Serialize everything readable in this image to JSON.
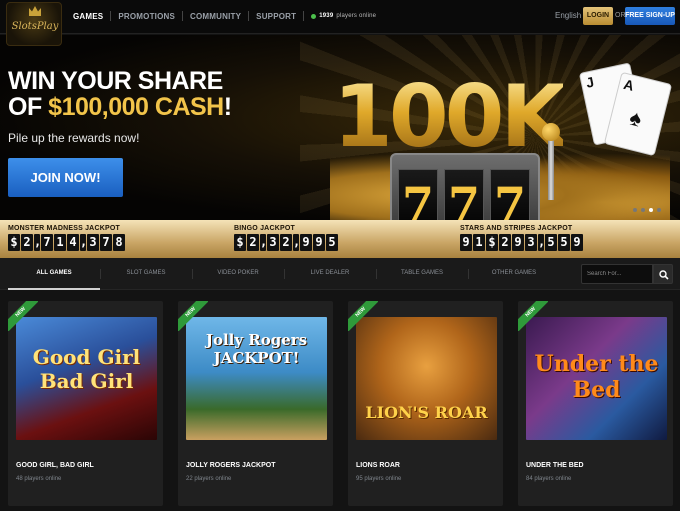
{
  "brand": {
    "logo_text": "SlotsPlay"
  },
  "nav": {
    "items": [
      "GAMES",
      "PROMOTIONS",
      "COMMUNITY",
      "SUPPORT"
    ],
    "online_count": "1939",
    "online_label": "players online"
  },
  "account": {
    "language": "English",
    "login": "LOGIN",
    "or": "OR",
    "signup": "FREE SIGN-UP"
  },
  "hero": {
    "line1": "WIN YOUR SHARE",
    "line2_prefix": "OF ",
    "line2_amount": "$100,000 CASH",
    "line2_suffix": "!",
    "subtitle": "Pile up the rewards now!",
    "cta": "JOIN NOW!",
    "art_text": "100K",
    "reels": [
      "7",
      "7",
      "7"
    ],
    "cards": [
      "J",
      "A"
    ],
    "active_slide": 3,
    "slide_count": 4
  },
  "jackpots": [
    {
      "label": "MONSTER MADNESS JACKPOT",
      "digits": [
        "$",
        "2",
        ",",
        "7",
        "1",
        "4",
        ",",
        "3",
        "7",
        "8"
      ]
    },
    {
      "label": "BINGO JACKPOT",
      "digits": [
        "$",
        "2",
        ",",
        "3",
        "2",
        ",",
        "9",
        "9",
        "5"
      ]
    },
    {
      "label": "STARS AND STRIPES JACKPOT",
      "digits": [
        "9",
        "1",
        "$",
        "2",
        "9",
        "3",
        ",",
        "5",
        "5",
        "9"
      ]
    }
  ],
  "tabs": [
    "ALL GAMES",
    "SLOT GAMES",
    "VIDEO POKER",
    "LIVE DEALER",
    "TABLE GAMES",
    "OTHER GAMES"
  ],
  "search": {
    "placeholder": "Search For..."
  },
  "games": [
    {
      "title": "GOOD GIRL, BAD GIRL",
      "players": "48 players online",
      "badge": "NEW",
      "art": "Good Girl Bad Girl"
    },
    {
      "title": "JOLLY ROGERS JACKPOT",
      "players": "22 players online",
      "badge": "NEW",
      "art": "Jolly Rogers JACKPOT!"
    },
    {
      "title": "LIONS ROAR",
      "players": "95 players online",
      "badge": "NEW",
      "art": "LION'S ROAR"
    },
    {
      "title": "UNDER THE BED",
      "players": "84 players online",
      "badge": "NEW",
      "art": "Under the Bed"
    }
  ],
  "colors": {
    "accent_blue": "#1a5fc0",
    "gold": "#f2c44a",
    "login_gold": "#c99a40",
    "online_green": "#4cc04c",
    "new_badge": "#2f9a3a"
  }
}
